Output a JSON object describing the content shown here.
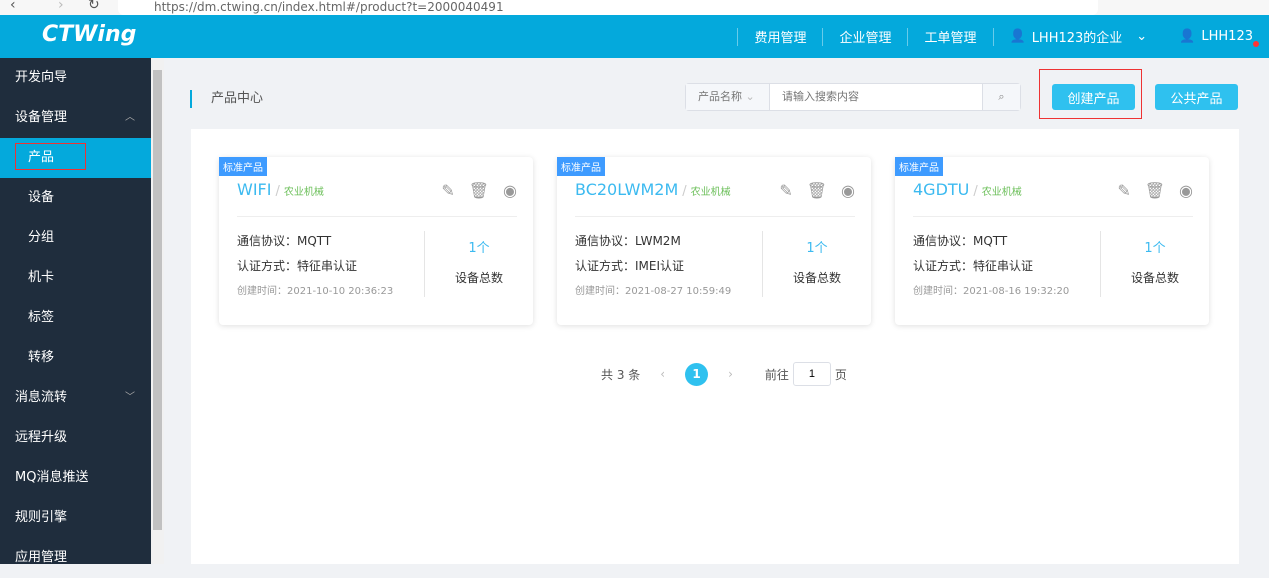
{
  "browser": {
    "url": "https://dm.ctwing.cn/index.html#/product?t=2000040491"
  },
  "header": {
    "logo": "CTWing",
    "nav": [
      "费用管理",
      "企业管理",
      "工单管理"
    ],
    "enterprise": "LHH123的企业",
    "user": "LHH123"
  },
  "sidebar": {
    "items": [
      {
        "label": "开发向导"
      },
      {
        "label": "设备管理"
      },
      {
        "label": "产品"
      },
      {
        "label": "设备"
      },
      {
        "label": "分组"
      },
      {
        "label": "机卡"
      },
      {
        "label": "标签"
      },
      {
        "label": "转移"
      },
      {
        "label": "消息流转"
      },
      {
        "label": "远程升级"
      },
      {
        "label": "MQ消息推送"
      },
      {
        "label": "规则引擎"
      },
      {
        "label": "应用管理"
      }
    ]
  },
  "page": {
    "title": "产品中心",
    "search_select": "产品名称",
    "search_placeholder": "请输入搜索内容",
    "create_btn": "创建产品",
    "public_btn": "公共产品"
  },
  "cards": [
    {
      "tag": "标准产品",
      "name": "WIFI",
      "category": "农业机械",
      "protocol": "通信协议：MQTT",
      "auth": "认证方式：特征串认证",
      "created": "创建时间：2021-10-10 20:36:23",
      "count": "1个",
      "count_label": "设备总数"
    },
    {
      "tag": "标准产品",
      "name": "BC20LWM2M",
      "category": "农业机械",
      "protocol": "通信协议：LWM2M",
      "auth": "认证方式：IMEI认证",
      "created": "创建时间：2021-08-27 10:59:49",
      "count": "1个",
      "count_label": "设备总数"
    },
    {
      "tag": "标准产品",
      "name": "4GDTU",
      "category": "农业机械",
      "protocol": "通信协议：MQTT",
      "auth": "认证方式：特征串认证",
      "created": "创建时间：2021-08-16 19:32:20",
      "count": "1个",
      "count_label": "设备总数"
    }
  ],
  "pagination": {
    "total": "共 3 条",
    "current": "1",
    "goto": "前往",
    "goto_value": "1",
    "page_suffix": "页"
  }
}
